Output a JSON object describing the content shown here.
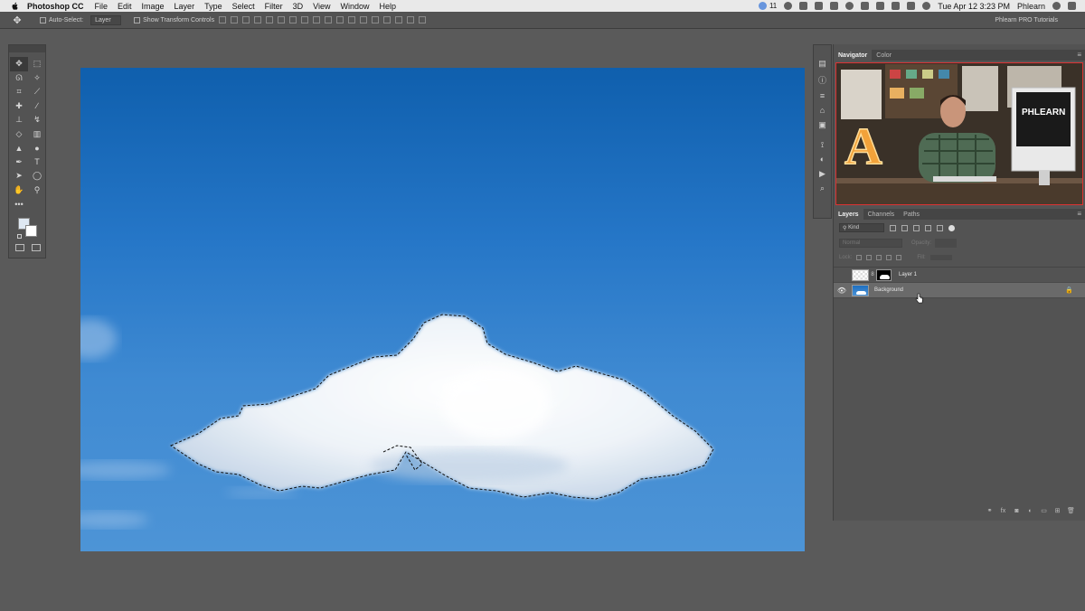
{
  "menubar": {
    "app_name": "Photoshop CC",
    "items": [
      "File",
      "Edit",
      "Image",
      "Layer",
      "Type",
      "Select",
      "Filter",
      "3D",
      "View",
      "Window",
      "Help"
    ],
    "status_badge": "11",
    "clock": "Tue Apr 12  3:23 PM",
    "user": "Phlearn"
  },
  "options_bar": {
    "auto_select_label": "Auto-Select:",
    "auto_select_value": "Layer",
    "transform_label": "Show Transform Controls",
    "right_text": "Phlearn PRO Tutorials"
  },
  "navigator": {
    "tabs": [
      "Navigator",
      "Color"
    ],
    "video_sign_text": "PHLEARN",
    "marquee_letter": "A"
  },
  "layers": {
    "tabs": [
      "Layers",
      "Channels",
      "Paths"
    ],
    "filter_kind": "Kind",
    "blend_mode": "Normal",
    "opacity_label": "Opacity:",
    "lock_label": "Lock:",
    "fill_label": "Fill:",
    "items": [
      {
        "name": "Layer 1",
        "visible": false,
        "selected": false
      },
      {
        "name": "Background",
        "visible": true,
        "selected": true
      }
    ]
  },
  "colors": {
    "sky_top": "#0f5fad",
    "sky_bottom": "#4d94d6",
    "panel": "#535353",
    "workspace": "#5a5a5a"
  }
}
